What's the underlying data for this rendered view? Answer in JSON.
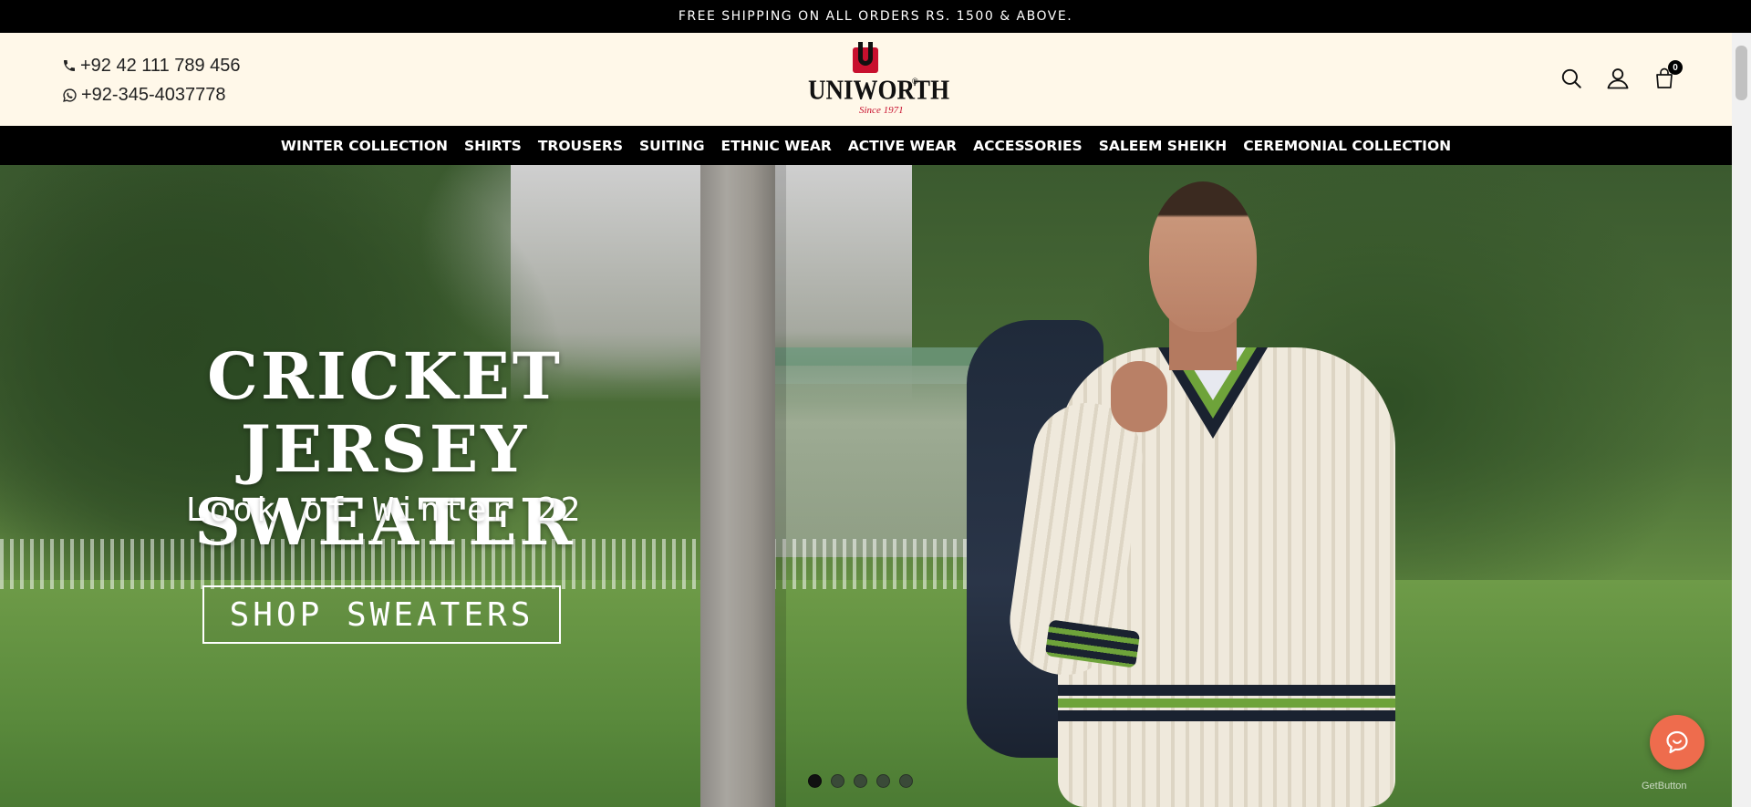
{
  "announcement": {
    "text": "FREE SHIPPING ON ALL ORDERS RS. 1500 & ABOVE."
  },
  "header": {
    "phone": "+92 42 111 789 456",
    "whatsapp": "+92-345-4037778",
    "logo": {
      "word": "UNIWORTH",
      "registered": "®",
      "since": "Since 1971",
      "colors": {
        "brand_red": "#c8102e",
        "brand_dark": "#111111"
      }
    },
    "icons": [
      "search-icon",
      "user-icon",
      "cart-icon"
    ],
    "cart_count": "0",
    "background": "#fff8e9"
  },
  "nav": {
    "items": [
      "WINTER COLLECTION",
      "SHIRTS",
      "TROUSERS",
      "SUITING",
      "ETHNIC WEAR",
      "ACTIVE WEAR",
      "ACCESSORIES",
      "SALEEM SHEIKH",
      "CEREMONIAL COLLECTION"
    ]
  },
  "hero": {
    "title_line1": "CRICKET",
    "title_line2": "JERSEY SWEATER",
    "subtitle": "Look of Winter 22",
    "cta": "SHOP SWEATERS",
    "slides_total": 5,
    "active_slide": 1
  },
  "chat": {
    "icon": "chat-bubble-icon",
    "brand": "GetButton",
    "color": "#ee6c4d"
  }
}
